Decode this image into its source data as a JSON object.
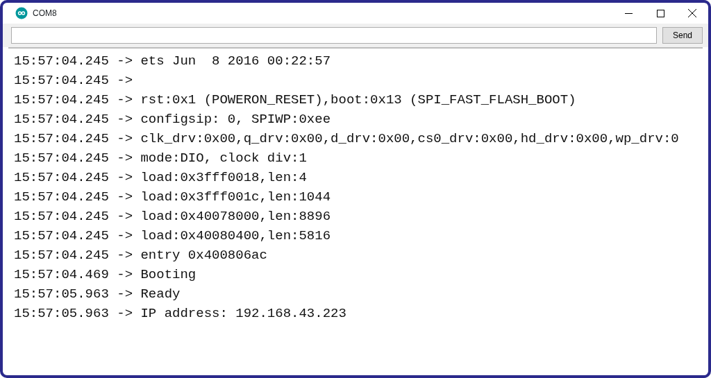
{
  "window": {
    "title": "COM8"
  },
  "send_button": "Send",
  "lines": [
    "15:57:04.245 -> ets Jun  8 2016 00:22:57",
    "15:57:04.245 ->",
    "15:57:04.245 -> rst:0x1 (POWERON_RESET),boot:0x13 (SPI_FAST_FLASH_BOOT)",
    "15:57:04.245 -> configsip: 0, SPIWP:0xee",
    "15:57:04.245 -> clk_drv:0x00,q_drv:0x00,d_drv:0x00,cs0_drv:0x00,hd_drv:0x00,wp_drv:0",
    "15:57:04.245 -> mode:DIO, clock div:1",
    "15:57:04.245 -> load:0x3fff0018,len:4",
    "15:57:04.245 -> load:0x3fff001c,len:1044",
    "15:57:04.245 -> load:0x40078000,len:8896",
    "15:57:04.245 -> load:0x40080400,len:5816",
    "15:57:04.245 -> entry 0x400806ac",
    "15:57:04.469 -> Booting",
    "15:57:05.963 -> Ready",
    "15:57:05.963 -> IP address: 192.168.43.223"
  ]
}
